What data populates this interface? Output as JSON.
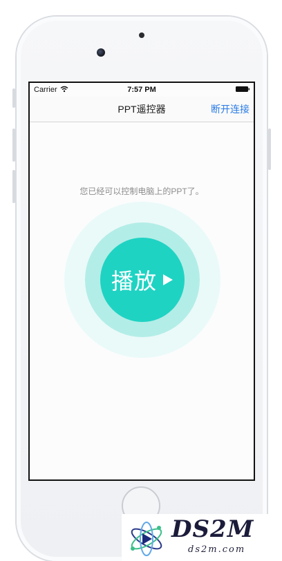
{
  "status_bar": {
    "carrier": "Carrier",
    "time": "7:57 PM"
  },
  "nav": {
    "title": "PPT遥控器",
    "disconnect_label": "断开连接"
  },
  "main": {
    "status_message": "您已经可以控制电脑上的PPT了。",
    "play_label": "播放"
  },
  "watermark": {
    "brand": "DS2M",
    "domain": "ds2m.com"
  },
  "colors": {
    "accent": "#1fd3c3",
    "ring_mid": "#b3ede7",
    "ring_outer": "#eafaf9",
    "link": "#2a7be4"
  },
  "icons": {
    "wifi": "wifi-icon",
    "battery": "battery-icon",
    "play": "play-icon"
  }
}
